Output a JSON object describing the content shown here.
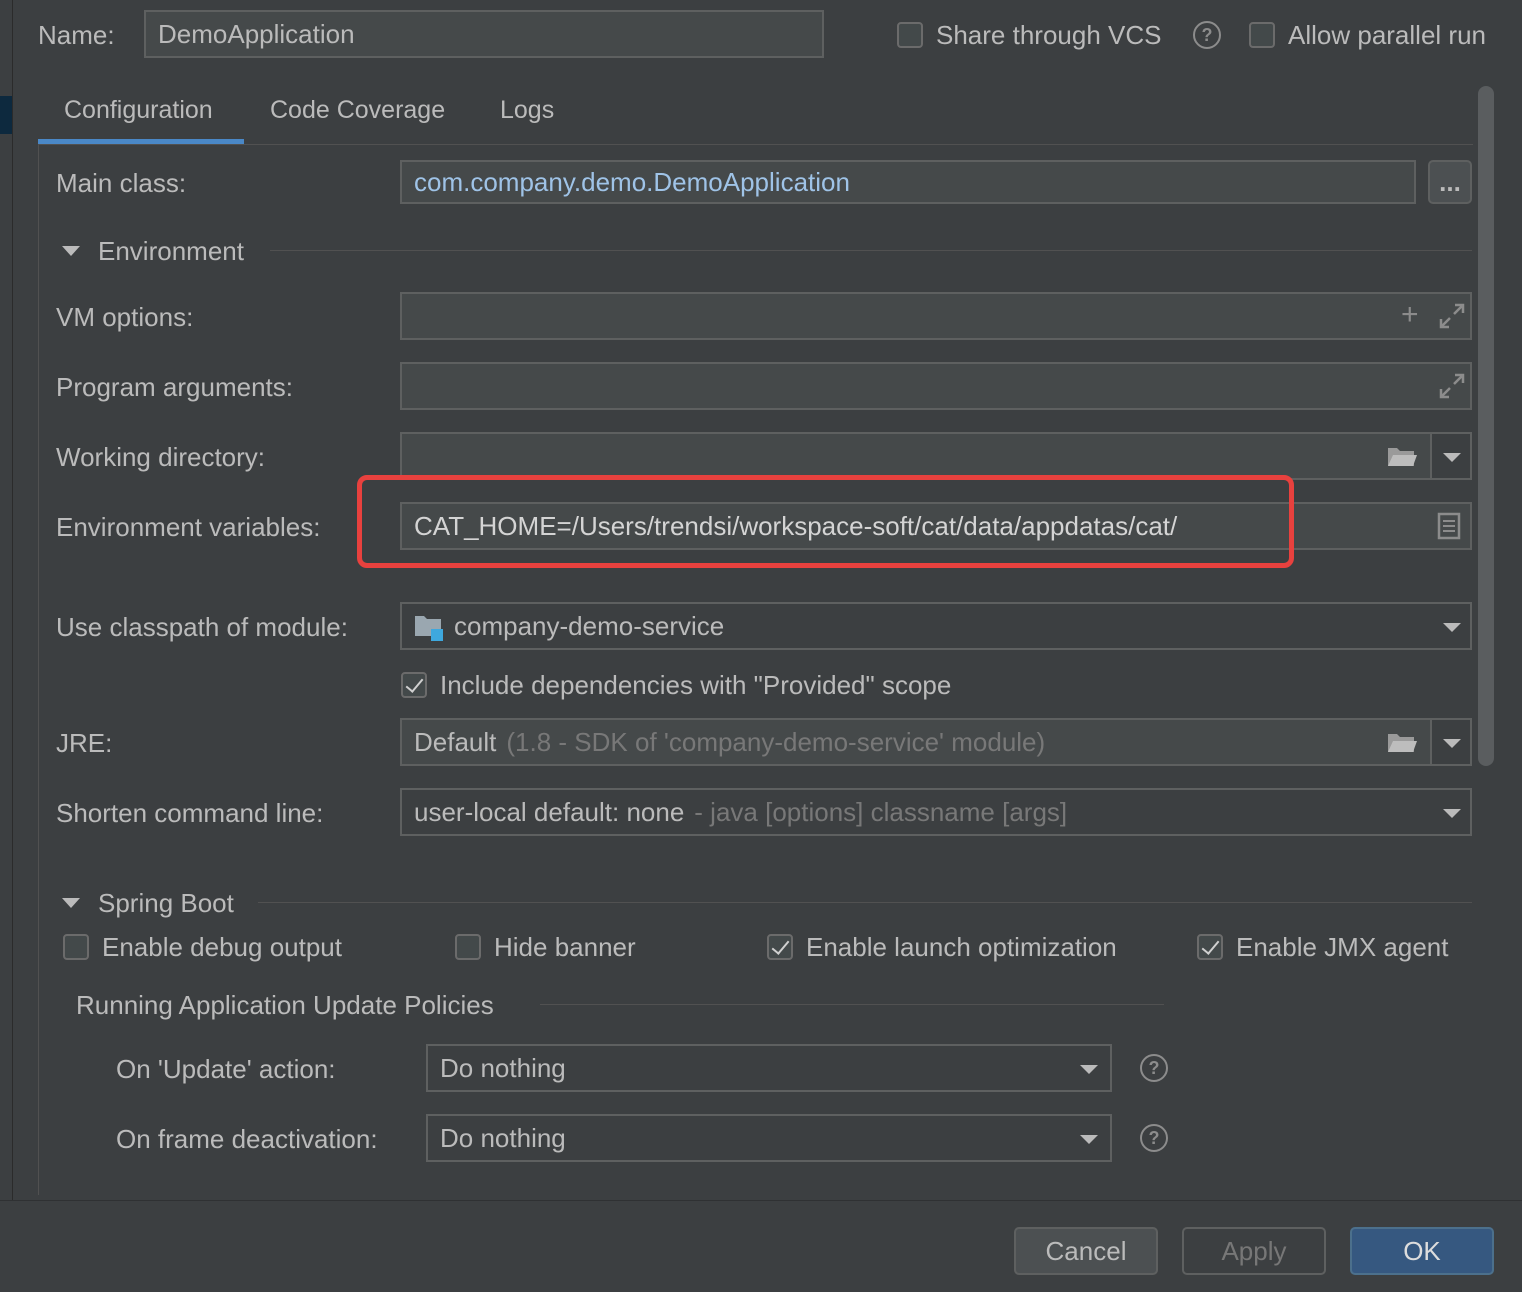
{
  "header": {
    "name_label": "Name:",
    "name_value": "DemoApplication",
    "share_vcs_label": "Share through VCS",
    "allow_parallel_label": "Allow parallel run"
  },
  "tabs": [
    {
      "label": "Configuration",
      "active": true
    },
    {
      "label": "Code Coverage",
      "active": false
    },
    {
      "label": "Logs",
      "active": false
    }
  ],
  "config": {
    "main_class_label": "Main class:",
    "main_class_value": "com.company.demo.DemoApplication",
    "browse_label": "...",
    "environment_section": "Environment",
    "vm_options_label": "VM options:",
    "vm_options_value": "",
    "program_args_label": "Program arguments:",
    "program_args_value": "",
    "working_dir_label": "Working directory:",
    "working_dir_value": "",
    "env_vars_label": "Environment variables:",
    "env_vars_value": "CAT_HOME=/Users/trendsi/workspace-soft/cat/data/appdatas/cat/",
    "classpath_label": "Use classpath of module:",
    "classpath_value": "company-demo-service",
    "include_provided_label": "Include dependencies with \"Provided\" scope",
    "include_provided_checked": true,
    "jre_label": "JRE:",
    "jre_value": "Default",
    "jre_hint": "(1.8 - SDK of 'company-demo-service' module)",
    "shorten_label": "Shorten command line:",
    "shorten_value": "user-local default: none",
    "shorten_hint": "- java [options] classname [args]"
  },
  "spring_boot": {
    "section": "Spring Boot",
    "debug_output_label": "Enable debug output",
    "hide_banner_label": "Hide banner",
    "launch_opt_label": "Enable launch optimization",
    "jmx_agent_label": "Enable JMX agent",
    "policies_section": "Running Application Update Policies",
    "on_update_label": "On 'Update' action:",
    "on_update_value": "Do nothing",
    "on_frame_label": "On frame deactivation:",
    "on_frame_value": "Do nothing"
  },
  "buttons": {
    "cancel": "Cancel",
    "apply": "Apply",
    "ok": "OK"
  },
  "colors": {
    "background": "#3c3f41",
    "highlight": "#e8413e",
    "accent": "#4a88c7",
    "primary_button": "#365880"
  }
}
